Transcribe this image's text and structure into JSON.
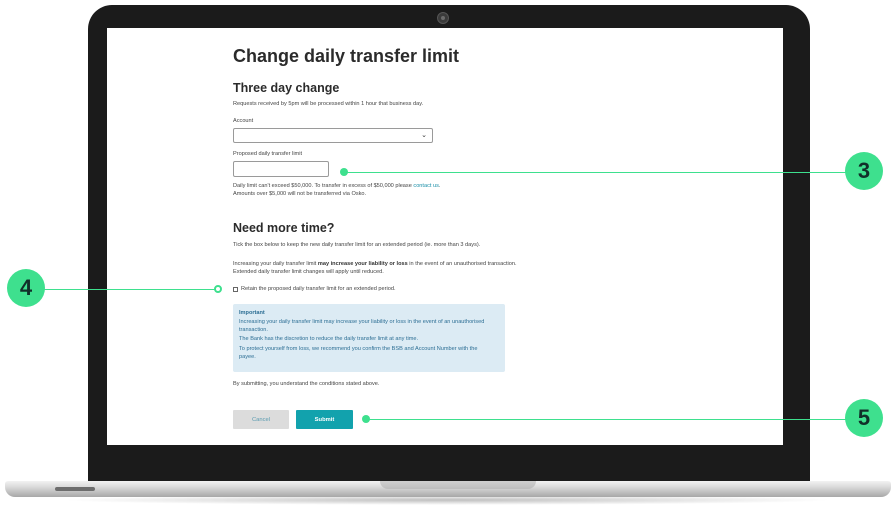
{
  "form": {
    "title": "Change daily transfer limit",
    "three_day": {
      "heading": "Three day change",
      "intro": "Requests received by 5pm will be processed within 1 hour that business day.",
      "account_label": "Account",
      "account_value": "",
      "limit_label": "Proposed daily transfer limit",
      "limit_value": "",
      "note_line1_prefix": "Daily limit can't exceed $50,000. To transfer in excess of $50,000 please ",
      "note_link": "contact us",
      "note_line1_suffix": ".",
      "note_line2": "Amounts over $5,000 will not be transferred via Osko."
    },
    "more_time": {
      "heading": "Need more time?",
      "intro": "Tick the box below to keep the new daily transfer limit for an extended period (ie. more than 3 days).",
      "warn_prefix": "Increasing your daily transfer limit ",
      "warn_bold": "may increase your liability or loss",
      "warn_suffix": " in the event of an unauthorised transaction.",
      "warn_line2": "Extended daily transfer limit changes will apply until reduced.",
      "checkbox_label": "Retain the proposed daily transfer limit for an extended period."
    },
    "important": {
      "title": "Important",
      "line1": "Increasing your daily transfer limit may increase your liability or loss in the event of an unauthorised",
      "line1b": "transaction.",
      "line2": "The Bank has the discretion to reduce the daily transfer limit at any time.",
      "line3": "To protect yourself from loss, we recommend you confirm the BSB and Account Number with the",
      "line3b": "payee."
    },
    "submit_note": "By submitting, you understand the conditions stated above.",
    "cancel_label": "Cancel",
    "submit_label": "Submit"
  },
  "callouts": [
    "3",
    "4",
    "5"
  ],
  "colors": {
    "accent": "#3ee08e",
    "submit": "#12a2ad",
    "info_bg": "#dcebf4",
    "link": "#1a8fa8"
  },
  "icons": {
    "select_chevron": "chevron-down-icon"
  }
}
